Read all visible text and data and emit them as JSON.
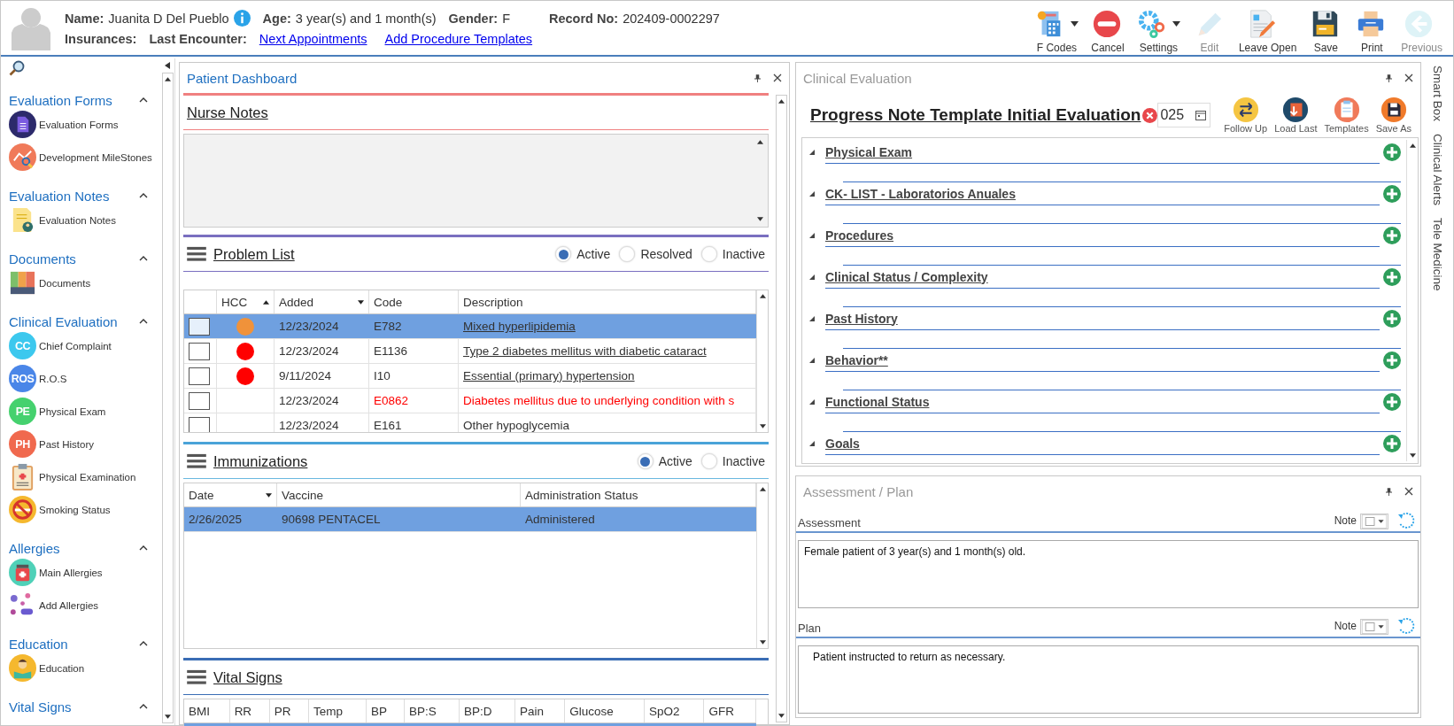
{
  "header": {
    "row1": [
      {
        "label": "Name:",
        "value": "Juanita D Del Pueblo"
      },
      {
        "label": "Age:",
        "value": "3 year(s) and 1 month(s)"
      },
      {
        "label": "Gender:",
        "value": "F"
      },
      {
        "label": "Record No:",
        "value": "202409-0002297"
      }
    ],
    "row2": [
      {
        "label": "Insurances:"
      },
      {
        "label": "Last Encounter:"
      }
    ],
    "links": [
      "Next Appointments",
      "Add Procedure Templates"
    ]
  },
  "toolbar": [
    {
      "kind": "fcodes",
      "label": "F Codes",
      "dropdown": true,
      "disabled": false
    },
    {
      "kind": "cancel",
      "label": "Cancel",
      "dropdown": false,
      "disabled": false
    },
    {
      "kind": "settings",
      "label": "Settings",
      "dropdown": true,
      "disabled": false
    },
    {
      "kind": "edit",
      "label": "Edit",
      "dropdown": false,
      "disabled": true
    },
    {
      "kind": "leave",
      "label": "Leave Open",
      "dropdown": false,
      "disabled": false
    },
    {
      "kind": "save",
      "label": "Save",
      "dropdown": false,
      "disabled": false
    },
    {
      "kind": "print",
      "label": "Print",
      "dropdown": false,
      "disabled": false
    },
    {
      "kind": "previous",
      "label": "Previous",
      "dropdown": false,
      "disabled": true
    }
  ],
  "sidebar": {
    "sections": [
      {
        "title": "Evaluation Forms",
        "expanded": true,
        "items": [
          {
            "kind": "form",
            "label": "Evaluation Forms"
          },
          {
            "kind": "chart",
            "label": "Development MileStones"
          }
        ]
      },
      {
        "title": "Evaluation Notes",
        "expanded": true,
        "items": [
          {
            "kind": "note",
            "label": "Evaluation Notes"
          }
        ]
      },
      {
        "title": "Documents",
        "expanded": true,
        "items": [
          {
            "kind": "binders",
            "label": "Documents"
          }
        ]
      },
      {
        "title": "Clinical Evaluation",
        "expanded": true,
        "items": [
          {
            "kind": "badge",
            "badge": "CC",
            "color": "#3cc8ee",
            "label": "Chief Complaint"
          },
          {
            "kind": "badge",
            "badge": "ROS",
            "color": "#4a86e8",
            "label": "R.O.S"
          },
          {
            "kind": "badge",
            "badge": "PE",
            "color": "#45d16e",
            "label": "Physical Exam"
          },
          {
            "kind": "badge",
            "badge": "PH",
            "color": "#f0694e",
            "label": "Past History"
          },
          {
            "kind": "clipboard",
            "label": "Physical Examination"
          },
          {
            "kind": "nosmoking",
            "label": "Smoking Status"
          }
        ]
      },
      {
        "title": "Allergies",
        "expanded": true,
        "items": [
          {
            "kind": "medicine",
            "label": "Main Allergies"
          },
          {
            "kind": "pills",
            "label": "Add Allergies"
          }
        ]
      },
      {
        "title": "Education",
        "expanded": true,
        "items": [
          {
            "kind": "reader",
            "label": "Education"
          }
        ]
      },
      {
        "title": "Vital Signs",
        "expanded": true
      }
    ]
  },
  "dashboard": {
    "title": "Patient Dashboard",
    "nurse_notes": {
      "title": "Nurse Notes"
    },
    "problem_list": {
      "title": "Problem List",
      "filters": [
        {
          "label": "Active",
          "selected": true
        },
        {
          "label": "Resolved",
          "selected": false
        },
        {
          "label": "Inactive",
          "selected": false
        }
      ],
      "columns": [
        {
          "label": "HCC",
          "kind": "sorted"
        },
        {
          "label": "Added",
          "kind": "dropdown"
        },
        {
          "label": "Code",
          "kind": "plain"
        },
        {
          "label": "Description",
          "kind": "plain"
        }
      ],
      "rows": [
        {
          "selected": true,
          "checked": false,
          "color": "#f0923a",
          "added": "12/23/2024",
          "code": "E782",
          "description": "Mixed hyperlipidemia",
          "kind": "link"
        },
        {
          "selected": false,
          "checked": false,
          "color": "#ff0000",
          "added": "12/23/2024",
          "code": "E1136",
          "description": "Type 2 diabetes mellitus with diabetic cataract",
          "kind": "link"
        },
        {
          "selected": false,
          "checked": false,
          "color": "#ff0000",
          "added": "9/11/2024",
          "code": "I10",
          "description": "Essential (primary) hypertension",
          "kind": "link"
        },
        {
          "selected": false,
          "checked": false,
          "added": "12/23/2024",
          "code": "E0862",
          "description": "Diabetes mellitus due to underlying condition with s",
          "kind": "alert"
        },
        {
          "selected": false,
          "checked": false,
          "added": "12/23/2024",
          "code": "E161",
          "description": "Other hypoglycemia",
          "kind": "plain"
        }
      ]
    },
    "immunizations": {
      "title": "Immunizations",
      "filters": [
        {
          "label": "Active",
          "selected": true
        },
        {
          "label": "Inactive",
          "selected": false
        }
      ],
      "columns": [
        {
          "label": "Date",
          "kind": "dropdown"
        },
        {
          "label": "Vaccine",
          "kind": "plain"
        },
        {
          "label": "Administration Status",
          "kind": "plain"
        }
      ],
      "rows": [
        {
          "selected": true,
          "date": "2/26/2025",
          "vaccine": "90698 PENTACEL",
          "status": "Administered"
        }
      ]
    },
    "vital_signs": {
      "title": "Vital Signs",
      "columns": [
        "BMI",
        "RR",
        "PR",
        "Temp",
        "BP",
        "BP:S",
        "BP:D",
        "Pain",
        "Glucose",
        "SpO2",
        "GFR"
      ]
    }
  },
  "clinical_evaluation": {
    "title": "Clinical Evaluation",
    "template": "Progress Note Template Initial Evaluation",
    "date": "025",
    "actions": [
      {
        "kind": "followup",
        "label": "Follow Up"
      },
      {
        "kind": "loadlast",
        "label": "Load Last"
      },
      {
        "kind": "templates",
        "label": "Templates"
      },
      {
        "kind": "saveas",
        "label": "Save As"
      }
    ],
    "sections": [
      {
        "title": "Physical Exam",
        "expanded": true
      },
      {
        "title": "CK- LIST - Laboratorios Anuales",
        "expanded": true
      },
      {
        "title": "Procedures",
        "expanded": true
      },
      {
        "title": "Clinical Status / Complexity",
        "expanded": true
      },
      {
        "title": "Past History",
        "expanded": true
      },
      {
        "title": "Behavior**",
        "expanded": true
      },
      {
        "title": "Functional Status",
        "expanded": true
      },
      {
        "title": "Goals",
        "expanded": true
      }
    ]
  },
  "assessment_plan": {
    "title": "Assessment / Plan",
    "blocks": [
      {
        "label": "Assessment",
        "note_label": "Note",
        "text": "Female patient of 3 year(s) and 1 month(s) old."
      },
      {
        "label": "Plan",
        "note_label": "Note",
        "text": "Patient instructed to return as necessary."
      }
    ]
  },
  "side_tabs": [
    "Smart Box",
    "Clinical Alerts",
    "Tele Medicine"
  ]
}
